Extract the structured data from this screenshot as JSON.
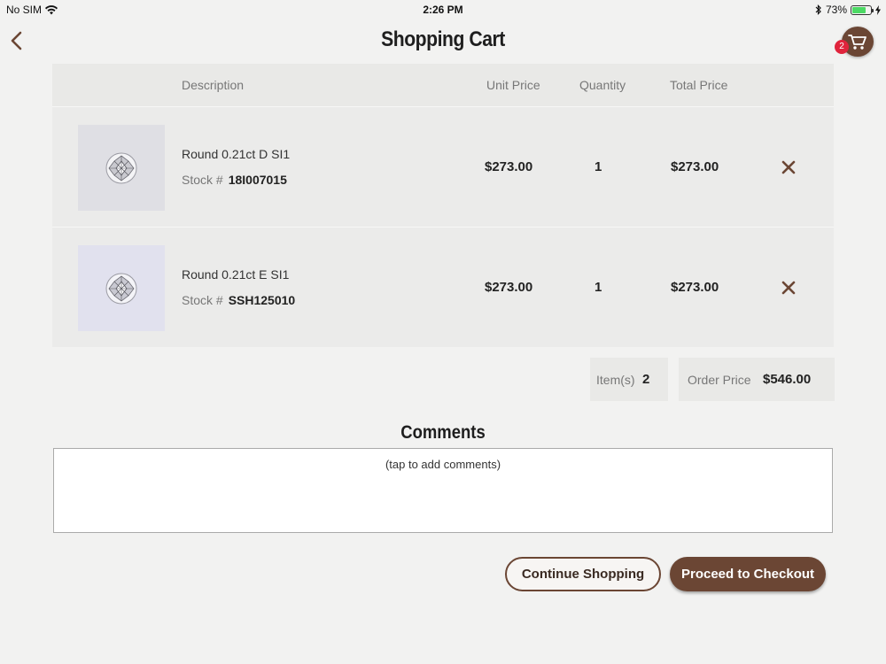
{
  "status_bar": {
    "carrier": "No SIM",
    "time": "2:26 PM",
    "battery_percent": "73%",
    "battery_level": 0.73
  },
  "header": {
    "title": "Shopping Cart",
    "cart_badge_count": "2"
  },
  "table": {
    "columns": {
      "description": "Description",
      "unit_price": "Unit Price",
      "quantity": "Quantity",
      "total_price": "Total Price"
    },
    "rows": [
      {
        "name": "Round 0.21ct D SI1",
        "stock_label": "Stock #",
        "stock_number": "18I007015",
        "unit_price": "$273.00",
        "quantity": "1",
        "total_price": "$273.00"
      },
      {
        "name": "Round 0.21ct E SI1",
        "stock_label": "Stock #",
        "stock_number": "SSH125010",
        "unit_price": "$273.00",
        "quantity": "1",
        "total_price": "$273.00"
      }
    ]
  },
  "summary": {
    "items_label": "Item(s)",
    "items_count": "2",
    "order_price_label": "Order Price",
    "order_price": "$546.00"
  },
  "comments": {
    "title": "Comments",
    "placeholder": "(tap to add comments)"
  },
  "buttons": {
    "continue_label": "Continue Shopping",
    "checkout_label": "Proceed to Checkout"
  },
  "colors": {
    "brand_brown": "#6b4634",
    "badge_red": "#e0243c",
    "battery_green": "#4cd964"
  }
}
